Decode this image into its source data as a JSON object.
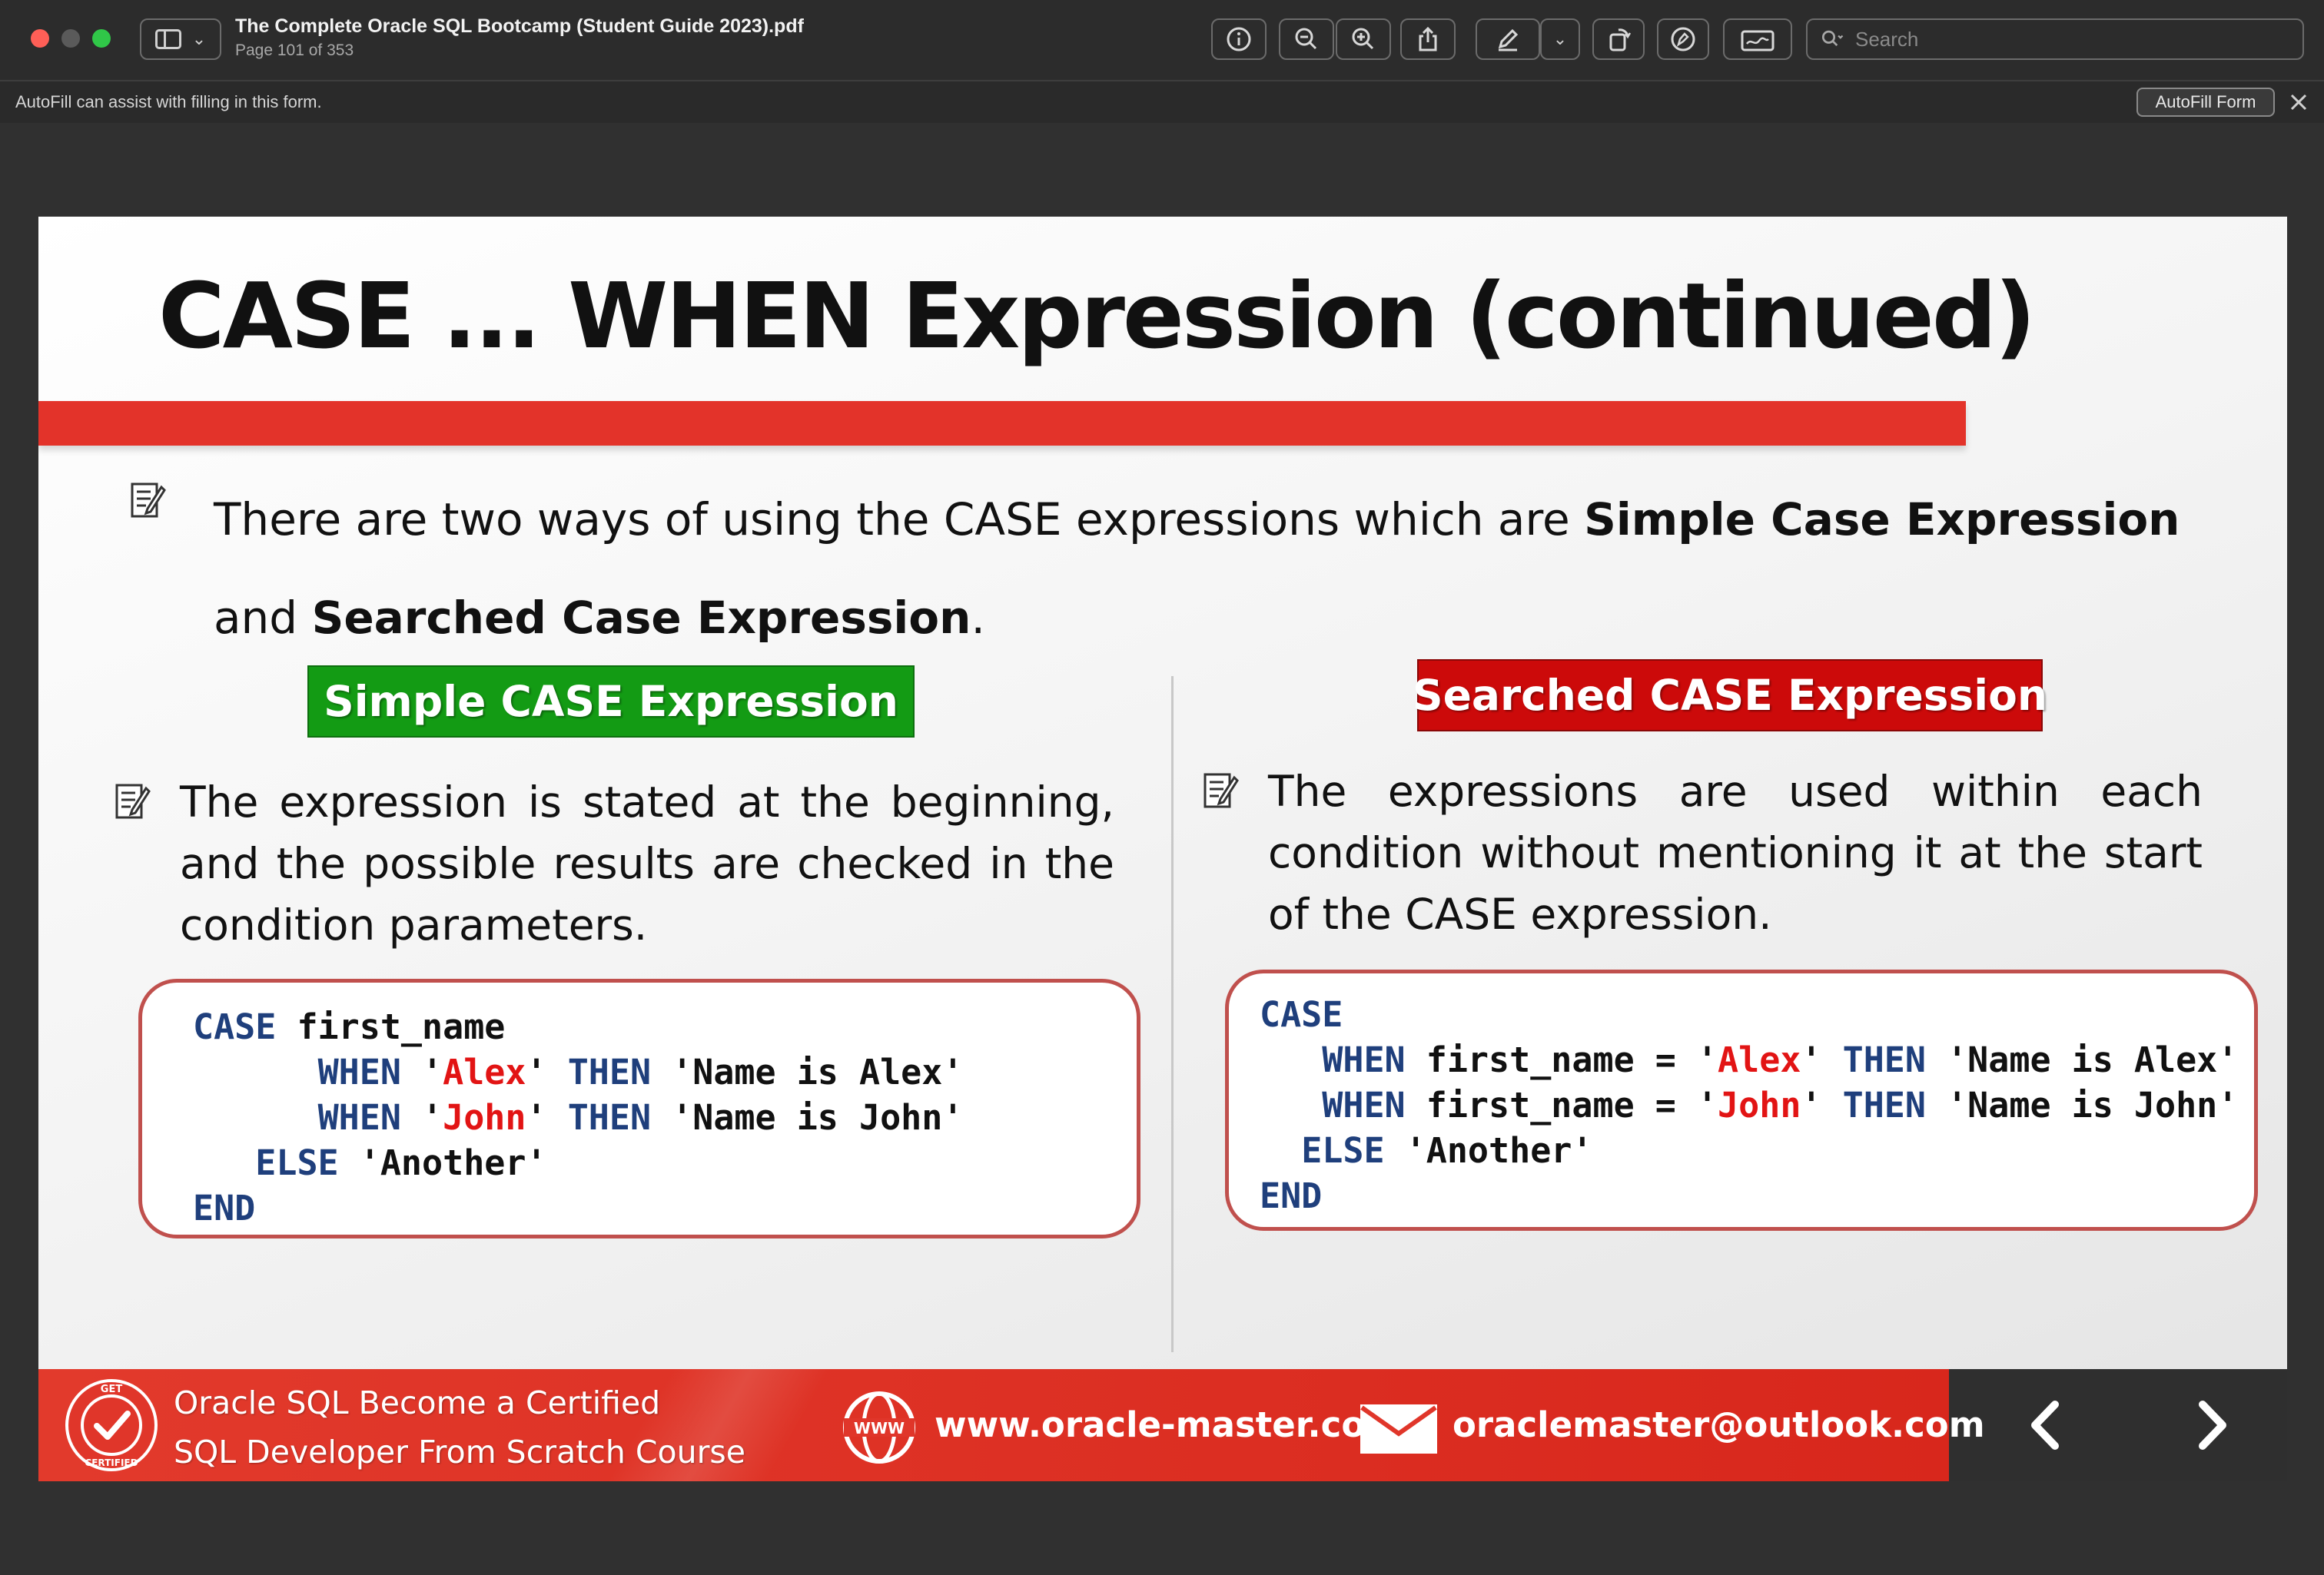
{
  "window": {
    "doc_title": "The Complete Oracle SQL Bootcamp (Student Guide 2023).pdf",
    "page_indicator": "Page 101 of 353",
    "search_placeholder": "Search"
  },
  "autofill": {
    "message": "AutoFill can assist with filling in this form.",
    "button_label": "AutoFill Form"
  },
  "slide": {
    "title": "CASE ... WHEN  Expression (continued)",
    "intro": {
      "text_1": "There are two ways of using the CASE expressions which are ",
      "bold_1": "Simple Case Expression",
      "text_2": " and ",
      "bold_2": "Searched Case Expression",
      "text_3": "."
    },
    "left": {
      "banner": "Simple CASE Expression",
      "description": "The expression is stated at the beginning, and the possible results are checked in the condition parameters.",
      "code": {
        "case_kw": "CASE",
        "expr": " first_name",
        "when_kw": "WHEN",
        "then_kw": "THEN",
        "else_kw": "ELSE",
        "end_kw": "END",
        "q": "'",
        "val_1": "Alex",
        "res_1": " 'Name is Alex'",
        "val_2": "John",
        "res_2": " 'Name is John'",
        "else_val": " 'Another'"
      }
    },
    "right": {
      "banner": "Searched CASE Expression",
      "description": "The expressions are used within each condition without mentioning it at the start of the CASE expression.",
      "code": {
        "case_kw": "CASE",
        "when_kw": "WHEN",
        "then_kw": "THEN",
        "else_kw": "ELSE",
        "end_kw": "END",
        "cond_prefix": " first_name = '",
        "q": "'",
        "val_1": "Alex",
        "res_1": " 'Name is Alex'",
        "val_2": "John",
        "res_2": " 'Name is John'",
        "else_val": " 'Another'"
      }
    },
    "footer": {
      "course_line_1": "Oracle SQL Become a Certified",
      "course_line_2": "SQL  Developer  From Scratch Course",
      "badge_top": "GET",
      "badge_bottom": "CERTIFIED",
      "www_label": "WWW",
      "website": "www.oracle-master.com",
      "email": "oraclemaster@outlook.com"
    }
  },
  "colors": {
    "title_bar_red": "#e3332a",
    "banner_green": "#139b14",
    "banner_red": "#cc0a0a",
    "code_keyword": "#1f3f7c",
    "code_string": "#e21414",
    "footer_red": "#e23a2c"
  },
  "icons": [
    "sidebar-icon",
    "info-icon",
    "zoom-out-icon",
    "zoom-in-icon",
    "share-icon",
    "markup-pen-icon",
    "rotate-icon",
    "markup-circle-icon",
    "sign-icon",
    "search-icon",
    "close-icon",
    "note-icon",
    "certified-badge-icon",
    "globe-www-icon",
    "mail-icon",
    "chevron-left-icon",
    "chevron-right-icon"
  ]
}
